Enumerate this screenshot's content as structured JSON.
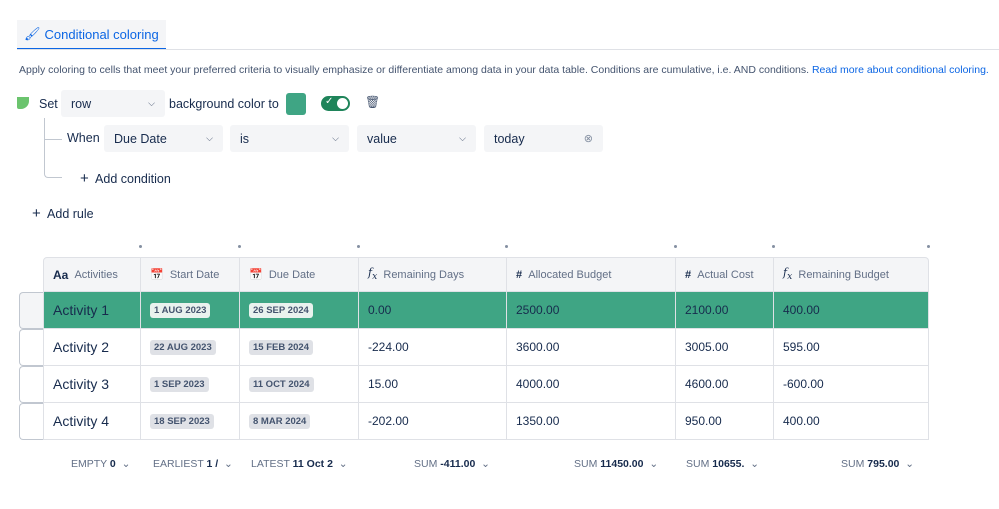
{
  "tab": {
    "label": "Conditional coloring",
    "icon": "paint-bucket-icon"
  },
  "description": {
    "text": "Apply coloring to cells that meet your preferred criteria to visually emphasize or differentiate among data in your data table. Conditions are cumulative, i.e. AND conditions. ",
    "link": "Read more about conditional coloring."
  },
  "rule": {
    "set_label": "Set",
    "target": "row",
    "color_label": "background color to",
    "color": "#3fa584",
    "enabled": true,
    "when_label": "When",
    "field": "Due Date",
    "operator": "is",
    "value_type": "value",
    "value": "today",
    "add_condition": "Add condition"
  },
  "add_rule": "Add rule",
  "columns": [
    {
      "label": "Activities",
      "icon": "Aa"
    },
    {
      "label": "Start Date",
      "icon": "calendar"
    },
    {
      "label": "Due Date",
      "icon": "calendar"
    },
    {
      "label": "Remaining Days",
      "icon": "fx"
    },
    {
      "label": "Allocated Budget",
      "icon": "#"
    },
    {
      "label": "Actual Cost",
      "icon": "#"
    },
    {
      "label": "Remaining Budget",
      "icon": "fx"
    }
  ],
  "rows": [
    [
      "Activity 1",
      "1 AUG 2023",
      "26 SEP 2024",
      "0.00",
      "2500.00",
      "2100.00",
      "400.00"
    ],
    [
      "Activity 2",
      "22 AUG 2023",
      "15 FEB 2024",
      "-224.00",
      "3600.00",
      "3005.00",
      "595.00"
    ],
    [
      "Activity 3",
      "1 SEP 2023",
      "11 OCT 2024",
      "15.00",
      "4000.00",
      "4600.00",
      "-600.00"
    ],
    [
      "Activity 4",
      "18 SEP 2023",
      "8 MAR 2024",
      "-202.00",
      "1350.00",
      "950.00",
      "400.00"
    ]
  ],
  "footer": [
    {
      "label": "EMPTY",
      "value": "0"
    },
    {
      "label": "EARLIEST",
      "value": "1 /"
    },
    {
      "label": "LATEST",
      "value": "11 Oct 2"
    },
    {
      "label": "SUM",
      "value": "-411.00"
    },
    {
      "label": "SUM",
      "value": "11450.00"
    },
    {
      "label": "SUM",
      "value": "10655."
    },
    {
      "label": "SUM",
      "value": "795.00"
    }
  ]
}
